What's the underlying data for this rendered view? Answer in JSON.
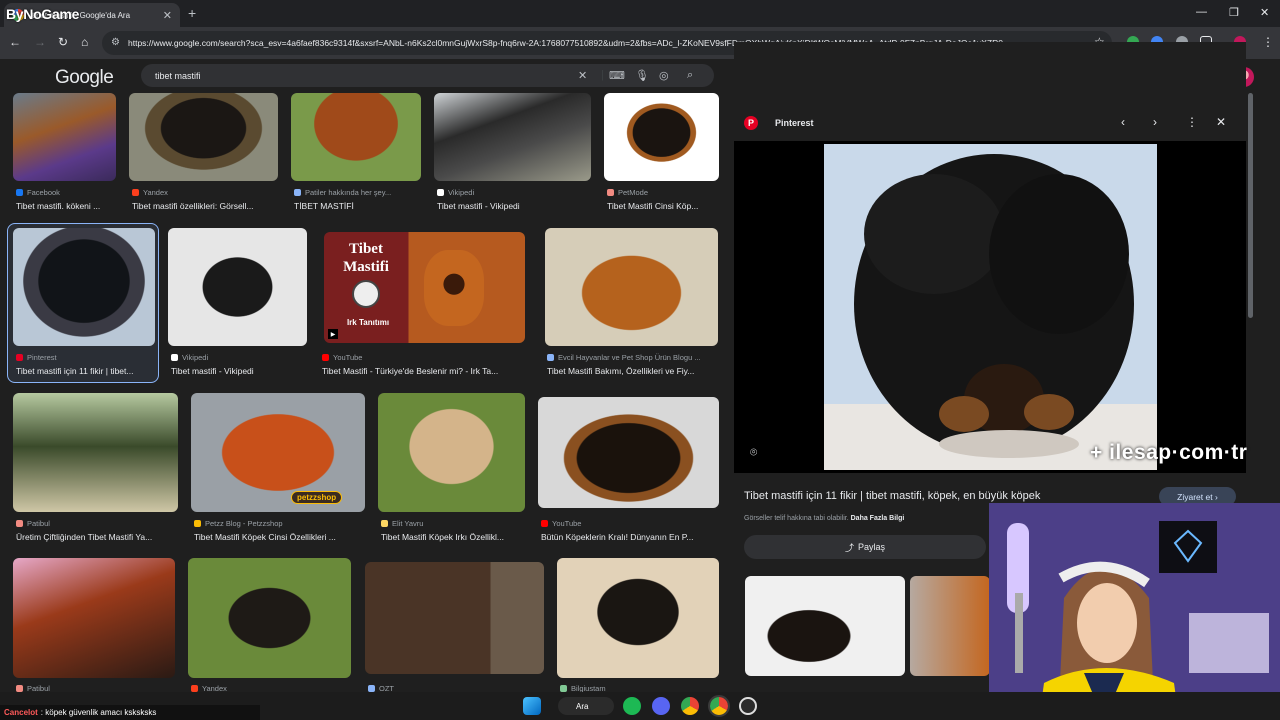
{
  "browser": {
    "overlay_brand": "ByNoGame",
    "tab_title": "tibet mastifi - Google'da Ara",
    "new_tab": "+",
    "url": "https://www.google.com/search?sca_esv=4a6faef836c9314f&sxsrf=ANbL-n6Ks2cl0mnGujWxrS8p-fnq6rw-2A:1768077510892&udm=2&fbs=ADc_l-ZKoNEV9sfFDmQXhWqAiyKpXjDItWOsMiVMWcA_AtdP-0FZnBrqJA-DoJOe1yXZR0..."
  },
  "google": {
    "logo": "Google",
    "query": "tibet mastifi"
  },
  "results": [
    {
      "source": "Facebook",
      "caption": "Tibet mastifi. kökeni ...",
      "icon_color": "#1877f2"
    },
    {
      "source": "Yandex",
      "caption": "Tibet mastifi özellikleri: Görsell...",
      "icon_color": "#fc3f1d"
    },
    {
      "source": "Patiler hakkında her şey...",
      "caption": "TİBET MASTİFİ",
      "icon_color": "#8ab4f8"
    },
    {
      "source": "Vikipedi",
      "caption": "Tibet mastifi - Vikipedi",
      "icon_color": "#ffffff"
    },
    {
      "source": "PetMode",
      "caption": "Tibet Mastifi Cinsi Köp...",
      "icon_color": "#f28b82"
    },
    {
      "source": "Pinterest",
      "caption": "Tibet mastifi için 11 fikir | tibet...",
      "icon_color": "#e60023"
    },
    {
      "source": "Vikipedi",
      "caption": "Tibet mastifi - Vikipedi",
      "icon_color": "#ffffff"
    },
    {
      "source": "YouTube",
      "caption": "Tibet Mastifi - Türkiye'de Beslenir mi? - Irk Ta...",
      "icon_color": "#ff0000"
    },
    {
      "source": "Evcil Hayvanlar ve Pet Shop Ürün Blogu ...",
      "caption": "Tibet Mastifi Bakımı, Özellikleri ve Fiy...",
      "icon_color": "#8ab4f8"
    },
    {
      "source": "Patibul",
      "caption": "Üretim Çiftliğinden Tibet Mastifi Ya...",
      "icon_color": "#f28b82"
    },
    {
      "source": "Petzz Blog - Petzzshop",
      "caption": "Tibet Mastifi Köpek Cinsi Özellikleri ...",
      "icon_color": "#fbbc05"
    },
    {
      "source": "Elit Yavru",
      "caption": "Tibet Mastifi Köpek Irkı Özellikl...",
      "icon_color": "#fdd663"
    },
    {
      "source": "YouTube",
      "caption": "Bütün Köpeklerin Kralı! Dünyanın En P...",
      "icon_color": "#ff0000"
    },
    {
      "source": "Patibul",
      "caption": "",
      "icon_color": "#f28b82"
    },
    {
      "source": "Yandex",
      "caption": "",
      "icon_color": "#fc3f1d"
    },
    {
      "source": "OZT",
      "caption": "",
      "icon_color": "#8ab4f8"
    },
    {
      "source": "Bilgiustam",
      "caption": "",
      "icon_color": "#81c995"
    }
  ],
  "thumb_overlay": {
    "title_line1": "Tibet",
    "title_line2": "Mastifi",
    "subtitle": "Irk Tanıtımı",
    "petzz": "petzzshop"
  },
  "panel": {
    "source": "Pinterest",
    "title": "Tibet mastifi için 11 fikir | tibet mastifi, köpek, en büyük köpek",
    "visit_label": "Ziyaret et",
    "copyright_text": "Görseller telif hakkına tabi olabilir.",
    "learn_more": "Daha Fazla Bilgi",
    "share_label": "Paylaş",
    "watermark": "+ ilesap·com·tr"
  },
  "stream": {
    "chat_user": "Cancelot",
    "chat_message": ": köpek güvenlik amacı ksksksks"
  },
  "taskbar": {
    "search_label": "Ara"
  }
}
